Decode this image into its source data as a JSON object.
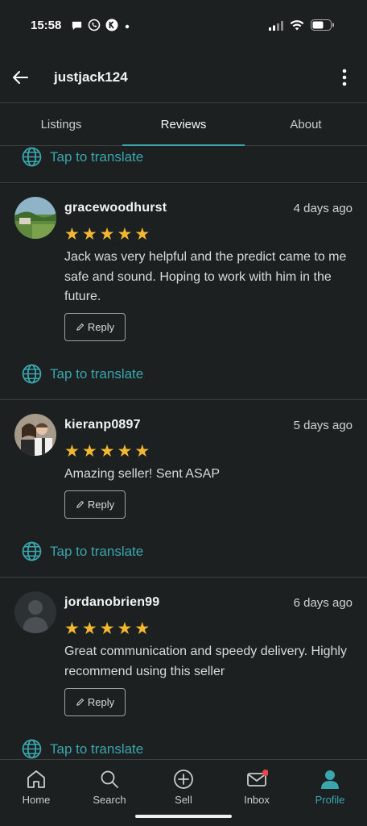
{
  "status_bar": {
    "time": "15:58"
  },
  "header": {
    "title": "justjack124"
  },
  "tabs": [
    {
      "label": "Listings",
      "active": false
    },
    {
      "label": "Reviews",
      "active": true
    },
    {
      "label": "About",
      "active": false
    }
  ],
  "translate_label": "Tap to translate",
  "reply_label": "Reply",
  "reviews": [
    {
      "username": "gracewoodhurst",
      "date": "4 days ago",
      "rating": 5,
      "text": "Jack was very helpful and the predict came to me safe and sound. Hoping to work with him in the future."
    },
    {
      "username": "kieranp0897",
      "date": "5 days ago",
      "rating": 5,
      "text": "Amazing seller! Sent ASAP"
    },
    {
      "username": "jordanobrien99",
      "date": "6 days ago",
      "rating": 5,
      "text": "Great communication and speedy delivery. Highly recommend using this seller"
    }
  ],
  "nav": [
    {
      "label": "Home",
      "icon": "home-icon"
    },
    {
      "label": "Search",
      "icon": "search-icon"
    },
    {
      "label": "Sell",
      "icon": "plus-circle-icon"
    },
    {
      "label": "Inbox",
      "icon": "mail-icon"
    },
    {
      "label": "Profile",
      "icon": "person-icon"
    }
  ],
  "colors": {
    "accent": "#3aa6ae",
    "star": "#f4b731",
    "notification": "#e5484d",
    "background": "#1c2021"
  }
}
